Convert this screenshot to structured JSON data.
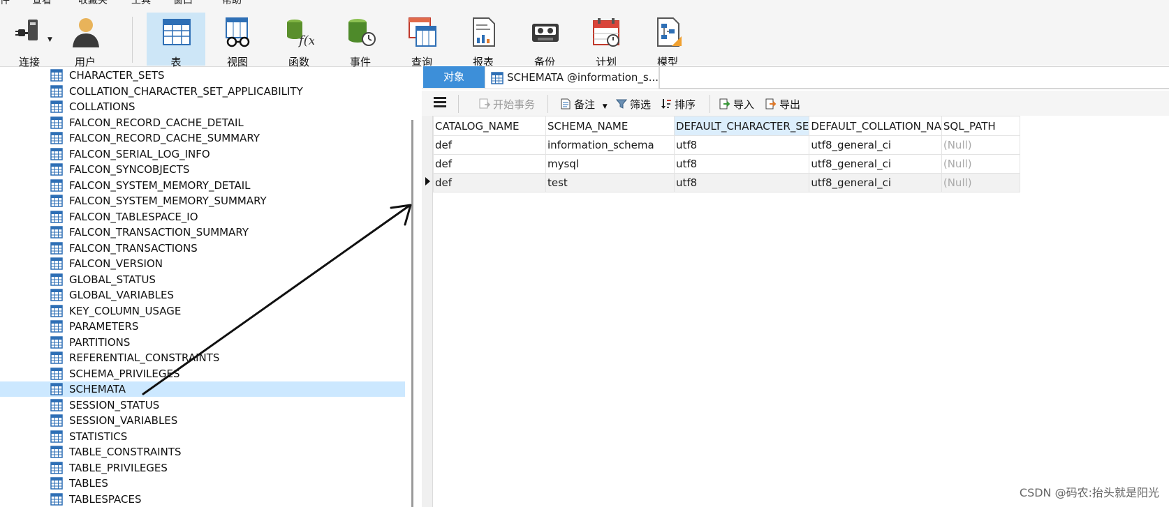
{
  "menu": [
    "件",
    "查看",
    "收藏夹",
    "工具",
    "窗口",
    "帮助"
  ],
  "toolbar": {
    "items": [
      {
        "label": "连接",
        "icon": "plug-icon"
      },
      {
        "label": "用户",
        "icon": "user-icon"
      },
      {
        "label": "表",
        "icon": "table-icon",
        "active": true
      },
      {
        "label": "视图",
        "icon": "view-icon"
      },
      {
        "label": "函数",
        "icon": "function-icon"
      },
      {
        "label": "事件",
        "icon": "event-icon"
      },
      {
        "label": "查询",
        "icon": "query-icon"
      },
      {
        "label": "报表",
        "icon": "report-icon"
      },
      {
        "label": "备份",
        "icon": "backup-icon"
      },
      {
        "label": "计划",
        "icon": "schedule-icon"
      },
      {
        "label": "模型",
        "icon": "model-icon"
      }
    ]
  },
  "tree": {
    "selected": "SCHEMATA",
    "items": [
      "CHARACTER_SETS",
      "COLLATION_CHARACTER_SET_APPLICABILITY",
      "COLLATIONS",
      "FALCON_RECORD_CACHE_DETAIL",
      "FALCON_RECORD_CACHE_SUMMARY",
      "FALCON_SERIAL_LOG_INFO",
      "FALCON_SYNCOBJECTS",
      "FALCON_SYSTEM_MEMORY_DETAIL",
      "FALCON_SYSTEM_MEMORY_SUMMARY",
      "FALCON_TABLESPACE_IO",
      "FALCON_TRANSACTION_SUMMARY",
      "FALCON_TRANSACTIONS",
      "FALCON_VERSION",
      "GLOBAL_STATUS",
      "GLOBAL_VARIABLES",
      "KEY_COLUMN_USAGE",
      "PARAMETERS",
      "PARTITIONS",
      "REFERENTIAL_CONSTRAINTS",
      "SCHEMA_PRIVILEGES",
      "SCHEMATA",
      "SESSION_STATUS",
      "SESSION_VARIABLES",
      "STATISTICS",
      "TABLE_CONSTRAINTS",
      "TABLE_PRIVILEGES",
      "TABLES",
      "TABLESPACES"
    ]
  },
  "tabs": {
    "objects": "对象",
    "doc": "SCHEMATA @information_s..."
  },
  "subtoolbar": {
    "menu_icon": "hamburger-icon",
    "begin_transaction": "开始事务",
    "memo": "备注",
    "filter": "筛选",
    "sort": "排序",
    "import": "导入",
    "export": "导出"
  },
  "grid": {
    "columns": [
      "CATALOG_NAME",
      "SCHEMA_NAME",
      "DEFAULT_CHARACTER_SE",
      "DEFAULT_COLLATION_NA",
      "SQL_PATH"
    ],
    "rows": [
      [
        "def",
        "information_schema",
        "utf8",
        "utf8_general_ci",
        "(Null)"
      ],
      [
        "def",
        "mysql",
        "utf8",
        "utf8_general_ci",
        "(Null)"
      ],
      [
        "def",
        "test",
        "utf8",
        "utf8_general_ci",
        "(Null)"
      ]
    ],
    "current_row": 2
  },
  "watermark": "CSDN @码农:抬头就是阳光",
  "colors": {
    "accent": "#3d8fd9",
    "selection": "#cce8ff",
    "header_highlight": "#dceefc"
  }
}
